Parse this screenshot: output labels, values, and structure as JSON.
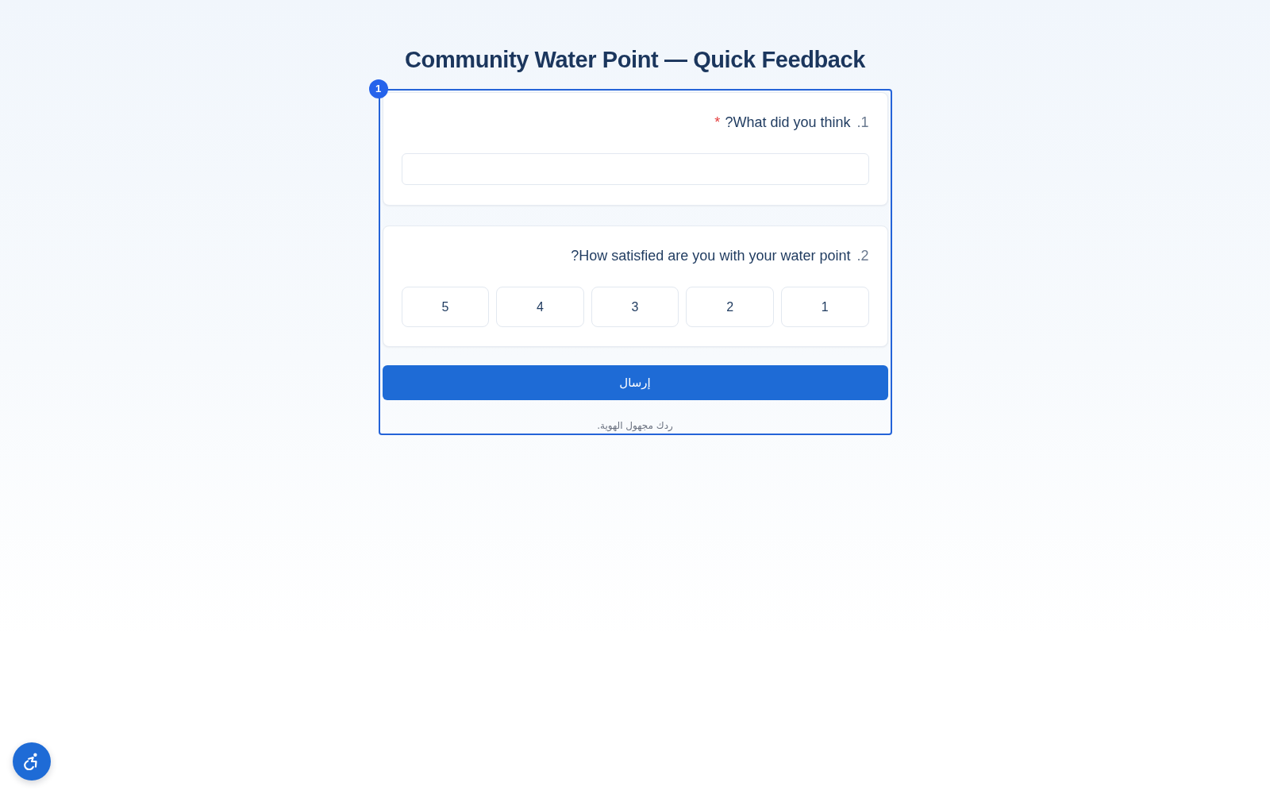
{
  "title": "Community Water Point — Quick Feedback",
  "highlight": {
    "badge": "1"
  },
  "questions": [
    {
      "kind": "text",
      "number": "1.",
      "label": "What did you think?",
      "required_mark": "*"
    },
    {
      "kind": "rating",
      "number": "2.",
      "label": "How satisfied are you with your water point?",
      "options": [
        {
          "label": "1",
          "selected": false
        },
        {
          "label": "2",
          "selected": false
        },
        {
          "label": "3",
          "selected": false
        },
        {
          "label": "4",
          "selected": false
        },
        {
          "label": "5",
          "selected": false
        }
      ]
    }
  ],
  "submit_button": "إرسال",
  "footer_note": "ردك مجهول الهوية.",
  "accessibility_button": true
}
